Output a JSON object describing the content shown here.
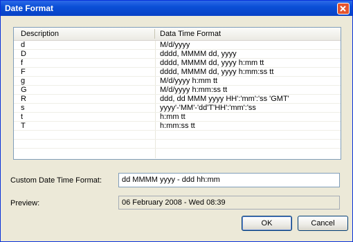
{
  "window": {
    "title": "Date Format"
  },
  "list": {
    "columns": [
      "Description",
      "Data Time Format"
    ],
    "rows": [
      [
        "d",
        "M/d/yyyy"
      ],
      [
        "D",
        "dddd, MMMM dd, yyyy"
      ],
      [
        "f",
        "dddd, MMMM dd, yyyy h:mm tt"
      ],
      [
        "F",
        "dddd, MMMM dd, yyyy h:mm:ss tt"
      ],
      [
        "g",
        "M/d/yyyy h:mm tt"
      ],
      [
        "G",
        "M/d/yyyy h:mm:ss tt"
      ],
      [
        "R",
        "ddd, dd MMM yyyy HH':'mm':'ss 'GMT'"
      ],
      [
        "s",
        "yyyy'-'MM'-'dd'T'HH':'mm':'ss"
      ],
      [
        "t",
        "h:mm tt"
      ],
      [
        "T",
        "h:mm:ss tt"
      ]
    ]
  },
  "custom": {
    "label": "Custom Date Time  Format:",
    "value": "dd MMMM yyyy - ddd hh:mm"
  },
  "preview": {
    "label": "Preview:",
    "value": "06 February 2008 - Wed 08:39"
  },
  "buttons": {
    "ok": "OK",
    "cancel": "Cancel"
  }
}
